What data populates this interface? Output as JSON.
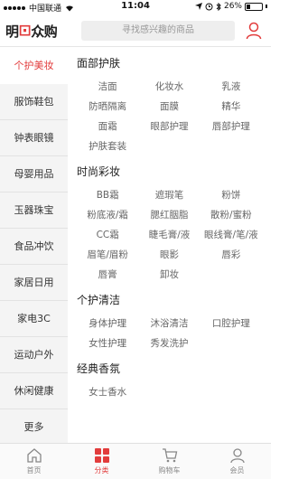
{
  "status_bar": {
    "carrier": "中国联通",
    "time": "11:04",
    "battery": "26%"
  },
  "header": {
    "logo_prefix": "明",
    "logo_suffix": "众购",
    "search_placeholder": "寻找感兴趣的商品"
  },
  "sidebar": {
    "items": [
      {
        "label": "个护美妆",
        "active": true
      },
      {
        "label": "服饰鞋包"
      },
      {
        "label": "钟表眼镜"
      },
      {
        "label": "母婴用品"
      },
      {
        "label": "玉器珠宝"
      },
      {
        "label": "食品冲饮"
      },
      {
        "label": "家居日用"
      },
      {
        "label": "家电3C"
      },
      {
        "label": "运动户外"
      },
      {
        "label": "休闲健康"
      },
      {
        "label": "更多"
      }
    ]
  },
  "sections": [
    {
      "title": "面部护肤",
      "items": [
        "洁面",
        "化妆水",
        "乳液",
        "防晒隔离",
        "面膜",
        "精华",
        "面霜",
        "眼部护理",
        "唇部护理",
        "护肤套装"
      ]
    },
    {
      "title": "时尚彩妆",
      "items": [
        "BB霜",
        "遮瑕笔",
        "粉饼",
        "粉底液/霜",
        "腮红胭脂",
        "散粉/蜜粉",
        "CC霜",
        "睫毛膏/液",
        "眼线膏/笔/液",
        "眉笔/眉粉",
        "眼影",
        "唇彩",
        "唇膏",
        "卸妆"
      ]
    },
    {
      "title": "个护清洁",
      "items": [
        "身体护理",
        "沐浴清洁",
        "口腔护理",
        "女性护理",
        "秀发洗护"
      ]
    },
    {
      "title": "经典香氛",
      "items": [
        "女士香水",
        "",
        ""
      ]
    }
  ],
  "tabbar": {
    "items": [
      {
        "label": "首页",
        "icon": "home-icon"
      },
      {
        "label": "分类",
        "icon": "category-icon",
        "active": true
      },
      {
        "label": "购物车",
        "icon": "cart-icon"
      },
      {
        "label": "会员",
        "icon": "member-icon"
      }
    ]
  },
  "colors": {
    "accent": "#e23c3c",
    "sidebar_bg": "#f4f4f4",
    "search_bg": "#eeeeee"
  }
}
